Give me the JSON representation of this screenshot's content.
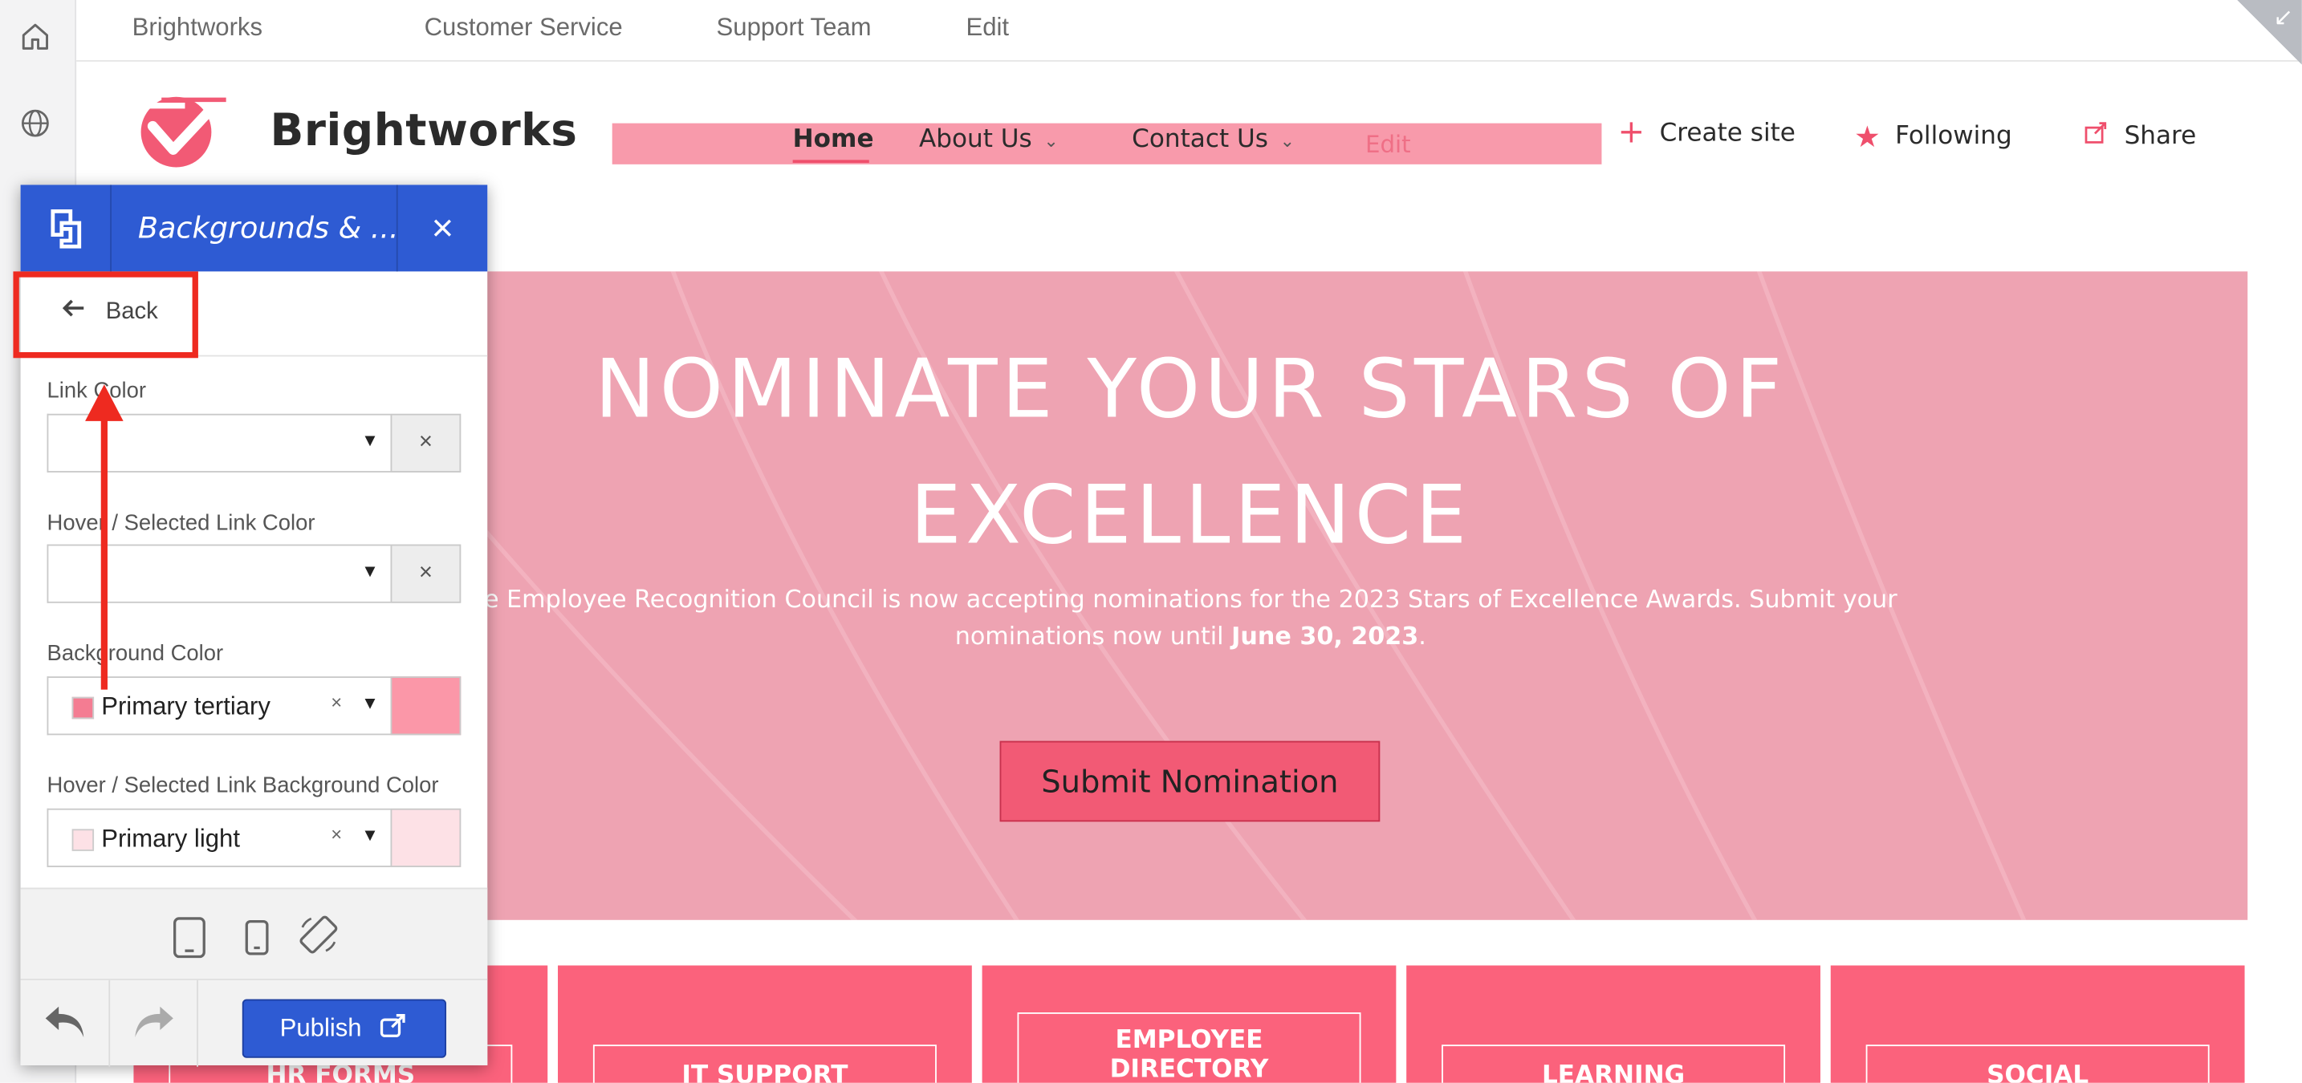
{
  "top_nav": {
    "items": [
      "Brightworks",
      "Customer Service",
      "Support Team",
      "Edit"
    ]
  },
  "site": {
    "name": "Brightworks",
    "nav": {
      "home": "Home",
      "about": "About Us",
      "contact": "Contact Us",
      "edit": "Edit"
    },
    "actions": {
      "create": "Create site",
      "following": "Following",
      "share": "Share"
    }
  },
  "hero": {
    "title_line1": "NOMINATE YOUR STARS OF",
    "title_line2": "EXCELLENCE",
    "text_part1": "e Employee Recognition Council is now accepting nominations for the 2023 Stars of Excellence Awards. Submit your nominations now until ",
    "text_bold": "June 30, 2023",
    "text_part2": ".",
    "button": "Submit Nomination"
  },
  "tiles": [
    {
      "label": "HR FORMS"
    },
    {
      "label": "IT SUPPORT"
    },
    {
      "label_line1": "EMPLOYEE",
      "label_line2": "DIRECTORY"
    },
    {
      "label": "LEARNING"
    },
    {
      "label": "SOCIAL"
    }
  ],
  "panel": {
    "title": "Backgrounds & ...",
    "back": "Back",
    "fields": {
      "link_color": {
        "label": "Link Color",
        "value": ""
      },
      "hover_link_color": {
        "label": "Hover / Selected Link Color",
        "value": ""
      },
      "background_color": {
        "label": "Background Color",
        "value": "Primary tertiary",
        "color": "#fb97a8"
      },
      "hover_bg_color": {
        "label": "Hover / Selected Link Background Color",
        "value": "Primary light",
        "color": "#fde1e6"
      }
    },
    "publish": "Publish"
  },
  "colors": {
    "brand_blue": "#2e5bd3",
    "accent_pink": "#fb627c",
    "hero_pink": "#eea3b2",
    "annotation_red": "#ee2a20"
  }
}
